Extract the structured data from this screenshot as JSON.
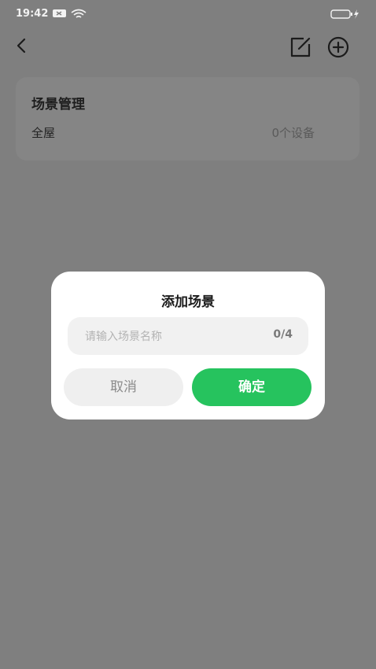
{
  "status": {
    "time": "19:42"
  },
  "card": {
    "title": "场景管理",
    "room": "全屋",
    "device_count": "0个设备"
  },
  "dialog": {
    "title": "添加场景",
    "input": {
      "placeholder": "请输入场景名称",
      "counter": "0/4"
    },
    "cancel_label": "取消",
    "confirm_label": "确定"
  },
  "colors": {
    "accent": "#26c35e",
    "overlay": "#7f7f7f"
  }
}
